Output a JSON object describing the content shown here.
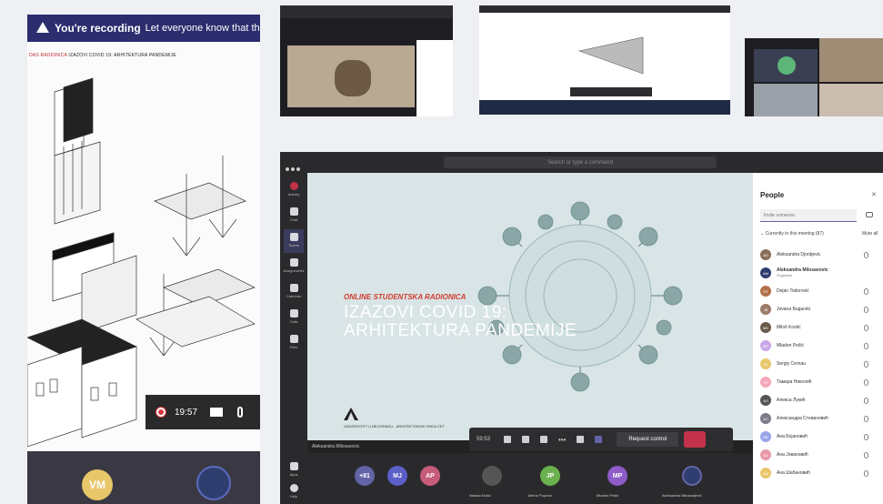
{
  "recording_banner": {
    "bold": "You're recording",
    "text": "Let everyone know that they're"
  },
  "document": {
    "title_red": "DAS RADIONICA",
    "title_rest": "IZAZOVI COVID 19: ARHITEKTURA PANDEMIJE"
  },
  "left_controls": {
    "timer": "19:57"
  },
  "left_participants": {
    "vm_initials": "VM"
  },
  "teams": {
    "search_placeholder": "Search or type a command",
    "rail": [
      "Activity",
      "Chat",
      "Teams",
      "Assignments",
      "Calendar",
      "Calls",
      "Files",
      "Apps",
      "Help"
    ],
    "slide": {
      "kicker": "ONLINE STUDENTSKA RADIONICA",
      "title_line1": "IZAZOVI COVID 19:",
      "title_line2": "ARHITEKTURA PANDEMIJE",
      "university": "UNIVERZITET U BEOGRADU - ARHITEKTONSKI FAKULTET"
    },
    "presenter_name": "Aleksandra Milosavovic",
    "call_bar": {
      "timer": "59:53",
      "request_control": "Request control"
    },
    "tiles": [
      {
        "initials": "+81",
        "color": "#6264a7"
      },
      {
        "initials": "MJ",
        "color": "#5b5fc7"
      },
      {
        "initials": "AP",
        "color": "#c75b7a"
      },
      {
        "initials": "",
        "name": "Nataša Đukić",
        "color": "#555"
      },
      {
        "initials": "JP",
        "name": "Jelena Pupović",
        "color": "#6ab04c"
      },
      {
        "initials": "MP",
        "name": "Mladen Pešić",
        "color": "#8e5bc7"
      },
      {
        "initials": "",
        "name": "Aleksandra Milosavljević",
        "color": "#2f3e6e"
      }
    ]
  },
  "people": {
    "title": "People",
    "invite_placeholder": "Invite someone",
    "meeting_header": "Currently in this meeting (87)",
    "mute_all": "Mute all",
    "list": [
      {
        "name": "Aleksandra Djordjevic",
        "initials": "AD",
        "color": "#8a6f5a"
      },
      {
        "name": "Aleksandra Milosavovic",
        "sub": "Organizer",
        "initials": "AM",
        "color": "#2f3e6e"
      },
      {
        "name": "Dejan Todorović",
        "initials": "DT",
        "color": "#b3704a"
      },
      {
        "name": "Jovana Bugarski",
        "initials": "JB",
        "color": "#9a7b6a"
      },
      {
        "name": "Miloš Kostić",
        "initials": "MK",
        "color": "#6a5a4a"
      },
      {
        "name": "Mladen Pešić",
        "initials": "MP",
        "color": "#c9a7e8"
      },
      {
        "name": "Sergiy Cernau",
        "initials": "SC",
        "color": "#e8c66a"
      },
      {
        "name": "Тамара Николић",
        "initials": "TH",
        "color": "#f4a7b9"
      },
      {
        "name": "Алекса Лукић",
        "initials": "АЛ",
        "color": "#555"
      },
      {
        "name": "Александра Стевановић",
        "initials": "АС",
        "color": "#7a7a8a"
      },
      {
        "name": "Ана Бојановић",
        "initials": "АБ",
        "color": "#9aa7e8"
      },
      {
        "name": "Ана Јовановић",
        "initials": "АЈ",
        "color": "#e89aa7"
      },
      {
        "name": "Ана Шабановић",
        "initials": "АШ",
        "color": "#e8c66a"
      }
    ]
  }
}
